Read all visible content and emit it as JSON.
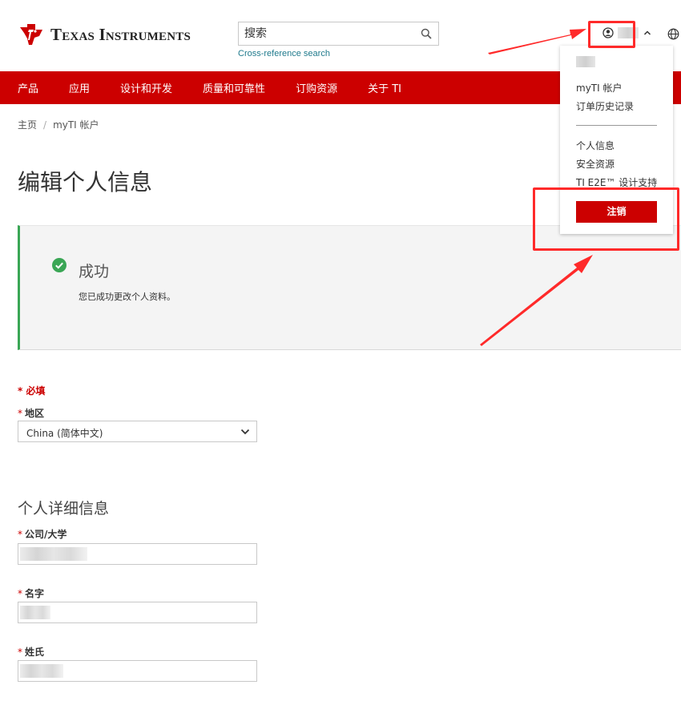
{
  "header": {
    "logo_text": "Texas Instruments",
    "search_placeholder": "搜索",
    "cross_reference": "Cross-reference search",
    "brand_color": "#cc0000"
  },
  "nav": {
    "items": [
      "产品",
      "应用",
      "设计和开发",
      "质量和可靠性",
      "订购资源",
      "关于 TI"
    ]
  },
  "breadcrumb": {
    "home": "主页",
    "separator": "/",
    "current": "myTI 帐户"
  },
  "page_title": "编辑个人信息",
  "success": {
    "title": "成功",
    "message": "您已成功更改个人资料。",
    "accent_color": "#3aa655"
  },
  "form": {
    "required_note": "* 必填",
    "required_mark": "*",
    "region_label": "地区",
    "region_value": "China (简体中文)",
    "personal_section": "个人详细信息",
    "company_label": "公司/大学",
    "first_name_label": "名字",
    "last_name_label": "姓氏"
  },
  "dropdown": {
    "items_top": [
      "myTI 帐户",
      "订单历史记录"
    ],
    "items_bottom": [
      "个人信息",
      "安全资源",
      "TI E2E™ 设计支持"
    ],
    "logout": "注销"
  },
  "annotation_color": "#ff2a2a"
}
